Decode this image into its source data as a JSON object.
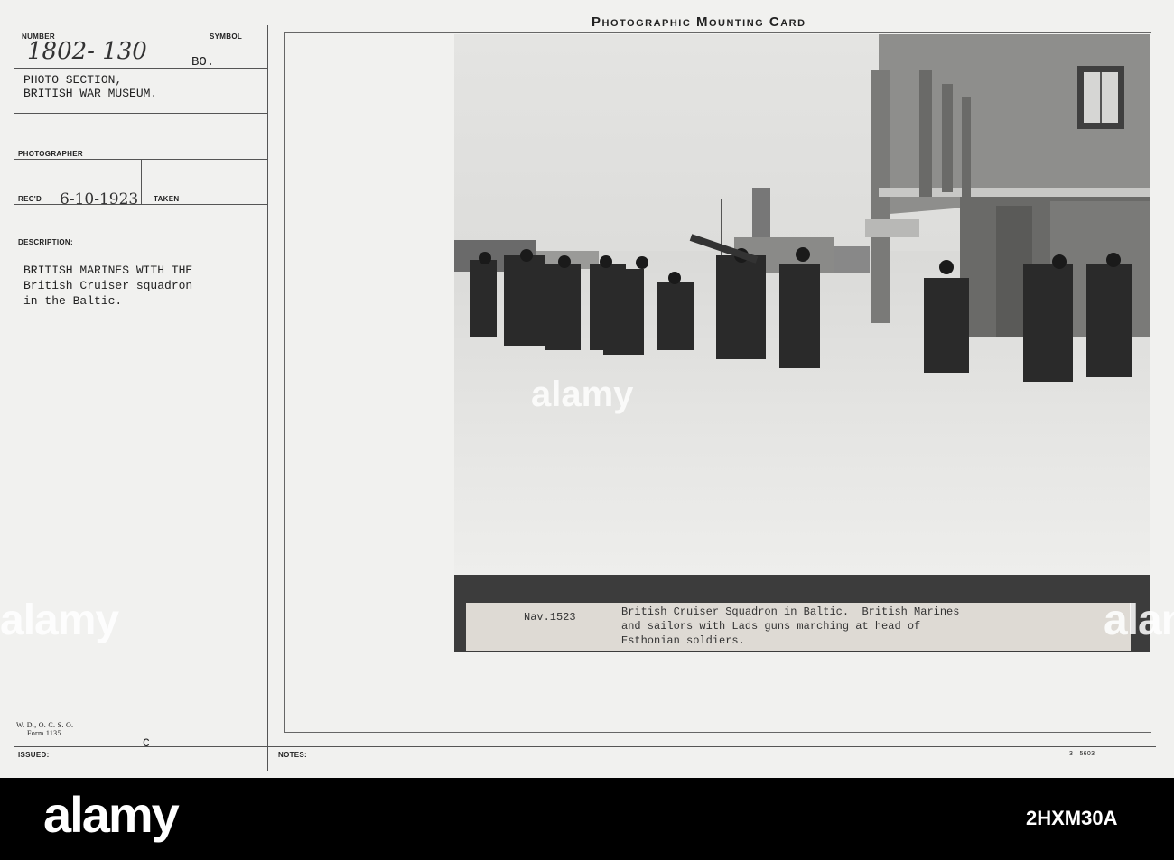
{
  "card": {
    "title": "Photographic Mounting Card",
    "number_label": "NUMBER",
    "number_value": "1802- 130",
    "symbol_label": "SYMBOL",
    "symbol_value": "BO.",
    "section_line1": "PHOTO SECTION,",
    "section_line2": "BRITISH WAR MUSEUM.",
    "photographer_label": "PHOTOGRAPHER",
    "recd_label": "REC'D",
    "recd_value": "6-10-1923",
    "taken_label": "TAKEN",
    "description_label": "DESCRIPTION:",
    "description_line1": "BRITISH MARINES WITH THE",
    "description_line2": "British Cruiser squadron",
    "description_line3": "in the Baltic.",
    "form_line1": "W. D., O. C. S. O.",
    "form_line2": "Form 1135",
    "issued_label": "ISSUED:",
    "issued_mark": "C",
    "notes_label": "NOTES:",
    "print_code": "3—5603"
  },
  "caption": {
    "ref": "Nav.1523",
    "line1": "British Cruiser Squadron in Baltic.  British Marines",
    "line2": "and sailors with Lads guns marching at head of",
    "line3": "Esthonian soldiers."
  },
  "watermark": {
    "text": "alamy",
    "image_id": "2HXM30A"
  }
}
